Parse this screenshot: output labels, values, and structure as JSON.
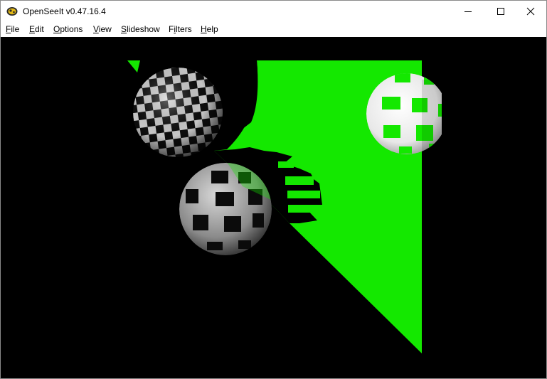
{
  "window": {
    "title": "OpenSeeIt v0.47.16.4",
    "app_icon": "openseeit-app-icon",
    "controls": [
      "minimize-icon",
      "maximize-icon",
      "close-icon"
    ]
  },
  "menu": {
    "items": [
      {
        "label": "File",
        "mnemonic": "F",
        "rest": "ile"
      },
      {
        "label": "Edit",
        "mnemonic": "E",
        "rest": "dit"
      },
      {
        "label": "Options",
        "mnemonic": "O",
        "rest": "ptions"
      },
      {
        "label": "View",
        "mnemonic": "V",
        "rest": "iew"
      },
      {
        "label": "Slideshow",
        "mnemonic": "S",
        "rest": "lideshow"
      },
      {
        "label": "Filters",
        "mnemonic": "F",
        "rest": "ilters",
        "pre": ""
      },
      {
        "label": "Help",
        "mnemonic": "H",
        "rest": "elp"
      }
    ]
  },
  "image": {
    "subject": "raytraced scene",
    "colors": {
      "background": "#000000",
      "plane": "#14e800",
      "checker_dark": "#111111",
      "checker_light": "#d8d8d8",
      "sphere_white": "#f2f2f2"
    }
  }
}
